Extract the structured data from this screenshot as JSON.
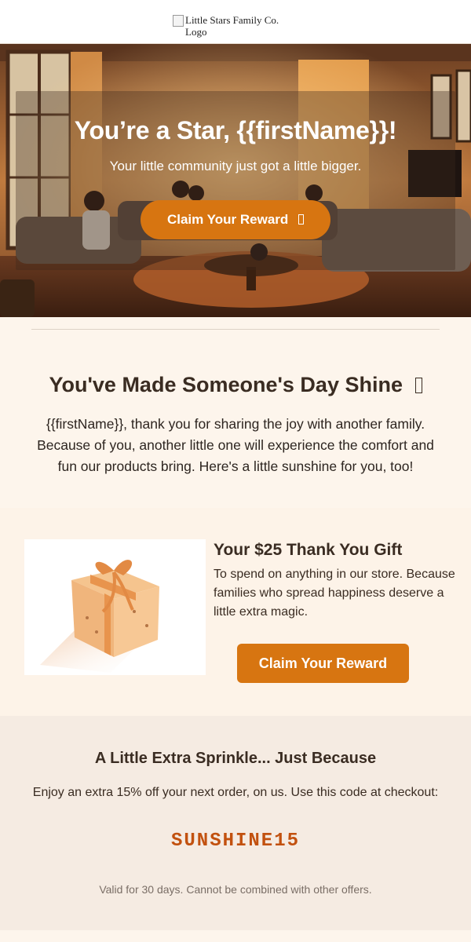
{
  "header": {
    "logo_alt_line1": "Little Stars Family Co.",
    "logo_alt_line2": "Logo"
  },
  "hero": {
    "title": "You’re a Star, {{firstName}}!",
    "subtitle": "Your little community just got a little bigger.",
    "button_label": "Claim Your Reward",
    "button_icon": "missing-glyph-icon"
  },
  "thanks": {
    "title": "You've Made Someone's Day Shine",
    "title_icon": "missing-glyph-icon",
    "body": "{{firstName}}, thank you for sharing the joy with another family. Because of you, another little one will experience the comfort and fun our products bring. Here's a little sunshine for you, too!"
  },
  "gift": {
    "title": "Your $25 Thank You Gift",
    "body": "To spend on anything in our store. Because families who spread happiness deserve a little extra magic.",
    "button_label": "Claim Your Reward",
    "image_icon": "gift-box-icon"
  },
  "promo": {
    "title": "A Little Extra Sprinkle... Just Because",
    "body": "Enjoy an extra 15% off your next order, on us. Use this code at checkout:",
    "code": "SUNSHINE15",
    "note": "Valid for 30 days. Cannot be combined with other offers."
  },
  "colors": {
    "accent": "#d77511",
    "code": "#c2510f",
    "background": "#fdf5ec",
    "promo_bg": "#f5ebe2"
  }
}
